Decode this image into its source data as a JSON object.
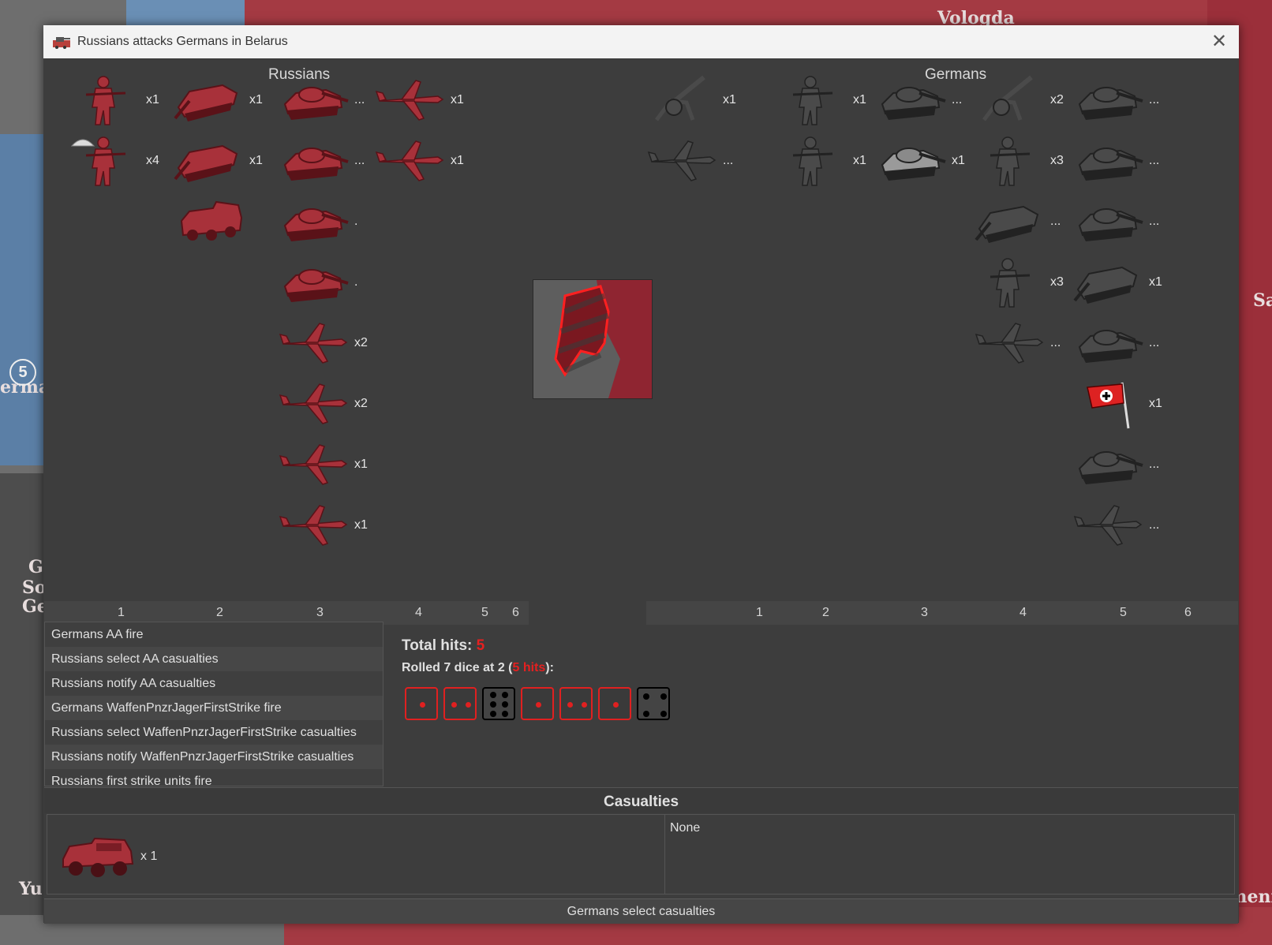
{
  "dialog": {
    "title": "Russians attacks Germans in Belarus",
    "close_icon": "close-icon"
  },
  "map_labels": {
    "vologda": "Vologda",
    "germany_partial": "ermar",
    "turkmenistan_partial": "Turkmeni",
    "sa_partial": "Sa",
    "g": "G",
    "so": "So",
    "ge": "Ge",
    "yu": "Yu",
    "badge": "5"
  },
  "attacker": {
    "name": "Russians",
    "color": "#a8313a",
    "units": [
      {
        "col": 1,
        "row": 1,
        "icon": "infantry-icon",
        "count": "x1"
      },
      {
        "col": 1,
        "row": 2,
        "icon": "paratrooper-icon",
        "count": "x4"
      },
      {
        "col": 2,
        "row": 1,
        "icon": "tank-destroyer-icon",
        "count": "x1"
      },
      {
        "col": 2,
        "row": 2,
        "icon": "tank-destroyer-icon",
        "count": "x1"
      },
      {
        "col": 2,
        "row": 3,
        "icon": "rocket-truck-icon",
        "count": ""
      },
      {
        "col": 3,
        "row": 1,
        "icon": "tank-icon",
        "count": "..."
      },
      {
        "col": 3,
        "row": 2,
        "icon": "tank-icon",
        "count": "..."
      },
      {
        "col": 3,
        "row": 3,
        "icon": "tank-icon",
        "count": "."
      },
      {
        "col": 3,
        "row": 4,
        "icon": "tank-icon",
        "count": "."
      },
      {
        "col": 3,
        "row": 5,
        "icon": "fighter-plane-icon",
        "count": "x2"
      },
      {
        "col": 3,
        "row": 6,
        "icon": "fighter-plane-icon",
        "count": "x2"
      },
      {
        "col": 3,
        "row": 7,
        "icon": "fighter-plane-icon",
        "count": "x1"
      },
      {
        "col": 3,
        "row": 8,
        "icon": "fighter-plane-icon",
        "count": "x1"
      },
      {
        "col": 4,
        "row": 1,
        "icon": "bomber-plane-icon",
        "count": "x1"
      },
      {
        "col": 4,
        "row": 2,
        "icon": "bomber-plane-icon",
        "count": "x1"
      }
    ],
    "columns": [
      "1",
      "2",
      "3",
      "4",
      "5",
      "6"
    ]
  },
  "defender": {
    "name": "Germans",
    "color": "#4a4a4a",
    "units": [
      {
        "col": 1,
        "row": 1,
        "icon": "aa-gun-icon",
        "count": "x1"
      },
      {
        "col": 1,
        "row": 2,
        "icon": "stuka-plane-icon",
        "count": "..."
      },
      {
        "col": 2,
        "row": 1,
        "icon": "rifleman-icon",
        "count": "x1"
      },
      {
        "col": 2,
        "row": 2,
        "icon": "rifleman-icon",
        "count": "x1"
      },
      {
        "col": 3,
        "row": 1,
        "icon": "tank-icon",
        "count": "..."
      },
      {
        "col": 3,
        "row": 2,
        "icon": "tiger-tank-icon",
        "count": "x1"
      },
      {
        "col": 4,
        "row": 1,
        "icon": "artillery-icon",
        "count": "x2"
      },
      {
        "col": 4,
        "row": 2,
        "icon": "elite-infantry-icon",
        "count": "x3"
      },
      {
        "col": 4,
        "row": 3,
        "icon": "tank-destroyer-icon",
        "count": "..."
      },
      {
        "col": 4,
        "row": 4,
        "icon": "soldier-icon",
        "count": "x3"
      },
      {
        "col": 4,
        "row": 5,
        "icon": "fighter-plane-icon",
        "count": "..."
      },
      {
        "col": 5,
        "row": 1,
        "icon": "tank-icon",
        "count": "..."
      },
      {
        "col": 5,
        "row": 2,
        "icon": "tank-icon",
        "count": "..."
      },
      {
        "col": 5,
        "row": 3,
        "icon": "tank-icon",
        "count": "..."
      },
      {
        "col": 5,
        "row": 4,
        "icon": "assault-gun-icon",
        "count": "x1"
      },
      {
        "col": 5,
        "row": 5,
        "icon": "heavy-tank-icon",
        "count": "..."
      },
      {
        "col": 5,
        "row": 6,
        "icon": "flag-icon",
        "count": "x1"
      },
      {
        "col": 5,
        "row": 7,
        "icon": "tank-icon",
        "count": "..."
      },
      {
        "col": 5,
        "row": 8,
        "icon": "bomber-plane-icon",
        "count": "..."
      }
    ],
    "columns": [
      "1",
      "2",
      "3",
      "4",
      "5",
      "6"
    ]
  },
  "steps": [
    "Germans AA fire",
    "Russians select AA casualties",
    "Russians notify AA casualties",
    "Germans WaffenPnzrJagerFirstStrike fire",
    "Russians select WaffenPnzrJagerFirstStrike casualties",
    "Russians notify WaffenPnzrJagerFirstStrike casualties",
    "Russians first strike units fire"
  ],
  "hits": {
    "total_label": "Total hits:",
    "total_value": "5",
    "rolled_prefix": "Rolled 7 dice at 2 (",
    "rolled_hits": "5 hits",
    "rolled_suffix": "):",
    "dice": [
      1,
      2,
      6,
      1,
      2,
      1,
      4
    ],
    "hit_flags": [
      true,
      true,
      false,
      true,
      true,
      true,
      false
    ]
  },
  "casualties": {
    "header": "Casualties",
    "left_unit_icon": "rocket-truck-icon",
    "left_count": "x 1",
    "right_text": "None"
  },
  "status": "Germans select  casualties"
}
